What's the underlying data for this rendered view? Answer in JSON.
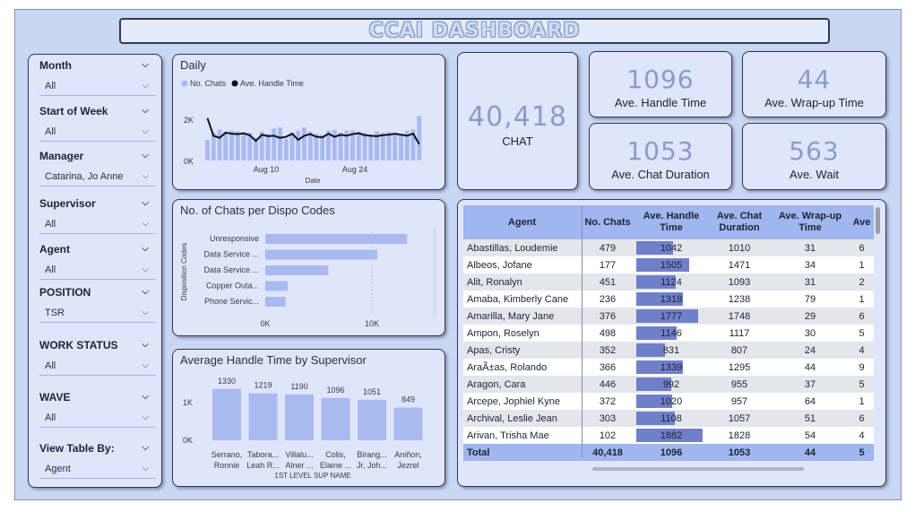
{
  "title": "CCAI DASHBOARD",
  "slicers": [
    {
      "label": "Month",
      "value": "All"
    },
    {
      "label": "Start of Week",
      "value": "All"
    },
    {
      "label": "Manager",
      "value": "Catarina, Jo Anne"
    },
    {
      "label": "Supervisor",
      "value": "All"
    },
    {
      "label": "Agent",
      "value": "All"
    },
    {
      "label": "POSITION",
      "value": "TSR"
    },
    {
      "label": "WORK STATUS",
      "value": "All"
    },
    {
      "label": "WAVE",
      "value": "All"
    },
    {
      "label": "View Table By:",
      "value": "Agent"
    }
  ],
  "daily": {
    "title": "Daily",
    "legend": [
      "No. Chats",
      "Ave. Handle Time"
    ],
    "y_ticks": [
      "2K",
      "0K"
    ],
    "x_ticks": [
      "Aug 10",
      "Aug 24"
    ],
    "xlabel": "Date"
  },
  "kpis": {
    "chat": {
      "value": "40,418",
      "label": "CHAT"
    },
    "aht": {
      "value": "1096",
      "label": "Ave. Handle Time"
    },
    "awt": {
      "value": "44",
      "label": "Ave. Wrap-up Time"
    },
    "acd": {
      "value": "1053",
      "label": "Ave. Chat Duration"
    },
    "wait": {
      "value": "563",
      "label": "Ave. Wait"
    }
  },
  "chart_data": [
    {
      "type": "bar",
      "title": "Daily",
      "xlabel": "Date",
      "x_ticks": [
        "Aug 10",
        "Aug 24"
      ],
      "series": [
        {
          "name": "No. Chats",
          "values": [
            1000,
            1350,
            1500,
            1400,
            1450,
            1400,
            1350,
            1350,
            1100,
            1400,
            1300,
            1550,
            1600,
            1050,
            1350,
            1450,
            1600,
            1400,
            1300,
            1250,
            1450,
            1500,
            1350,
            1450,
            1450,
            1400,
            1350,
            1250,
            1400,
            1350,
            1400,
            1300,
            1250,
            1450,
            1500,
            2150
          ]
        },
        {
          "name": "Ave. Handle Time",
          "values": [
            2050,
            1200,
            1100,
            1350,
            1300,
            1280,
            1320,
            1220,
            950,
            1250,
            1180,
            1200,
            1100,
            1150,
            1300,
            1000,
            1200,
            1280,
            1150,
            1120,
            1300,
            1150,
            1250,
            1200,
            1280,
            1320,
            1230,
            1200,
            1180,
            1230,
            1250,
            1300,
            1250,
            1200,
            1300,
            800
          ]
        }
      ]
    },
    {
      "type": "bar",
      "title": "No. of Chats per Dispo Codes",
      "ylabel": "Disposition Codes",
      "categories": [
        "Unresponsive",
        "Data Service ...",
        "Data Service ...",
        "Copper Outa...",
        "Phone Servic..."
      ],
      "values": [
        13300,
        10500,
        5900,
        2100,
        1900
      ],
      "x_ticks": [
        "0K",
        "10K"
      ]
    },
    {
      "type": "bar",
      "title": "Average Handle Time by Supervisor",
      "xlabel": "1ST LEVEL SUP NAME",
      "categories": [
        [
          "Serrano,",
          "Ronnie"
        ],
        [
          "Tabora...",
          "Leah R..."
        ],
        [
          "Villalu...",
          "Alner ..."
        ],
        [
          "Colis,",
          "Elaine ..."
        ],
        [
          "Birang...",
          "Jr, Joh..."
        ],
        [
          "Aniñon,",
          "Jezrel"
        ]
      ],
      "values": [
        1330,
        1219,
        1190,
        1096,
        1051,
        849
      ],
      "y_ticks": [
        "1K",
        "0K"
      ]
    }
  ],
  "table": {
    "columns": [
      "Agent",
      "No. Chats",
      "Ave. Handle Time",
      "Ave. Chat Duration",
      "Ave. Wrap-up Time",
      "Ave"
    ],
    "rows": [
      [
        "Abastillas, Loudemie",
        "479",
        "1042",
        "1010",
        "31",
        "6"
      ],
      [
        "Albeos, Jofane",
        "177",
        "1505",
        "1471",
        "34",
        "1"
      ],
      [
        "Alit, Ronalyn",
        "451",
        "1124",
        "1093",
        "31",
        "2"
      ],
      [
        "Amaba, Kimberly Cane",
        "236",
        "1318",
        "1238",
        "79",
        "1"
      ],
      [
        "Amarilla, Mary Jane",
        "376",
        "1777",
        "1748",
        "29",
        "6"
      ],
      [
        "Ampon, Roselyn",
        "498",
        "1146",
        "1117",
        "30",
        "5"
      ],
      [
        "Apas, Cristy",
        "352",
        "831",
        "807",
        "24",
        "4"
      ],
      [
        "AraÃ±as, Rolando",
        "366",
        "1339",
        "1295",
        "44",
        "9"
      ],
      [
        "Aragon, Cara",
        "446",
        "992",
        "955",
        "37",
        "5"
      ],
      [
        "Arcepe, Jophiel Kyne",
        "372",
        "1020",
        "957",
        "64",
        "1"
      ],
      [
        "Archival, Leslie Jean",
        "303",
        "1108",
        "1057",
        "51",
        "6"
      ],
      [
        "Arivan, Trisha Mae",
        "102",
        "1882",
        "1828",
        "54",
        "4"
      ]
    ],
    "total": [
      "Total",
      "40,418",
      "1096",
      "1053",
      "44",
      "5"
    ]
  }
}
